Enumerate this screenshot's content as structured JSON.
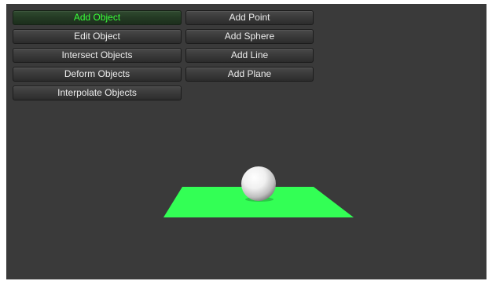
{
  "menu": {
    "left": [
      {
        "label": "Add Object",
        "active": true
      },
      {
        "label": "Edit Object",
        "active": false
      },
      {
        "label": "Intersect Objects",
        "active": false
      },
      {
        "label": "Deform Objects",
        "active": false
      },
      {
        "label": "Interpolate Objects",
        "active": false
      }
    ],
    "right": [
      {
        "label": "Add Point"
      },
      {
        "label": "Add Sphere"
      },
      {
        "label": "Add Line"
      },
      {
        "label": "Add Plane"
      }
    ]
  },
  "scene": {
    "plane_color": "#33ff55",
    "sphere_color": "#f2f2f2",
    "background_color": "#3a3a3a",
    "active_text_color": "#39ff39"
  }
}
